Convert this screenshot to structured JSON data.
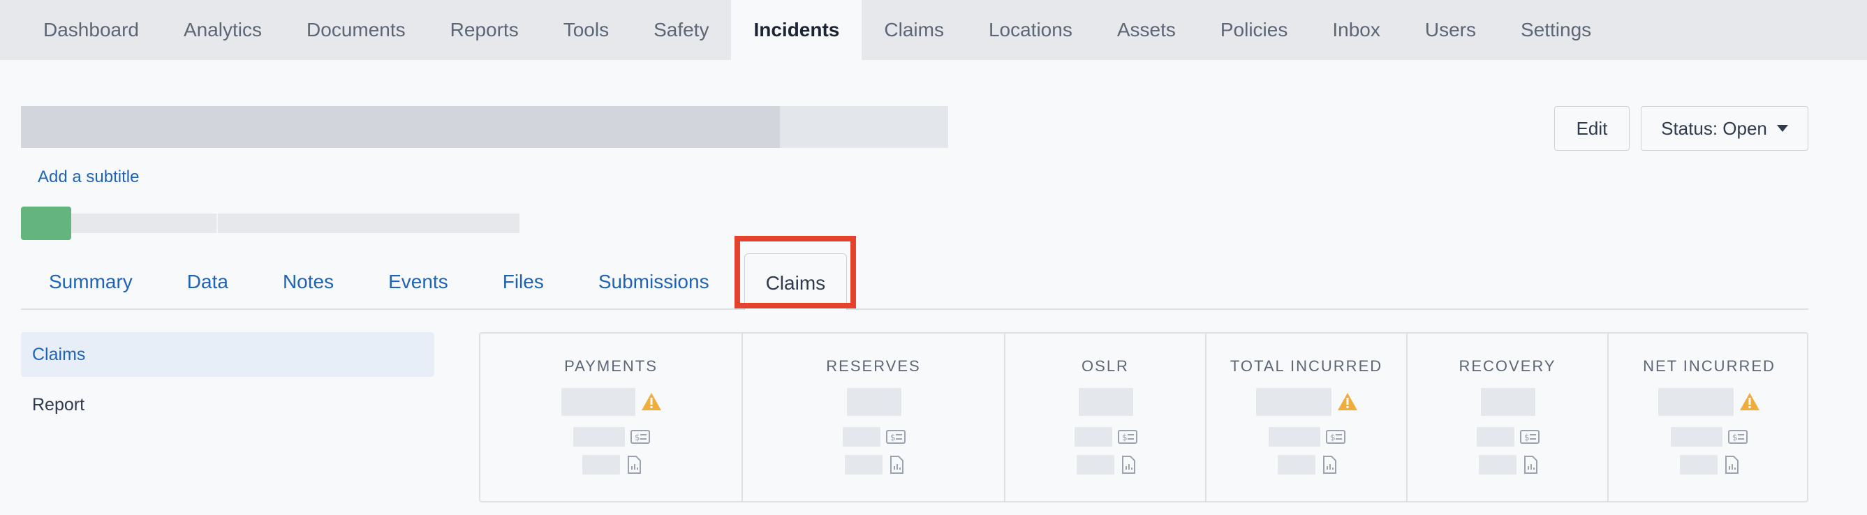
{
  "nav": {
    "items": [
      "Dashboard",
      "Analytics",
      "Documents",
      "Reports",
      "Tools",
      "Safety",
      "Incidents",
      "Claims",
      "Locations",
      "Assets",
      "Policies",
      "Inbox",
      "Users",
      "Settings"
    ],
    "active": "Incidents"
  },
  "header": {
    "subtitle_link": "Add a subtitle",
    "edit_label": "Edit",
    "status_label": "Status: Open"
  },
  "tabs": {
    "items": [
      "Summary",
      "Data",
      "Notes",
      "Events",
      "Files",
      "Submissions",
      "Claims"
    ],
    "active": "Claims"
  },
  "sidebar": {
    "items": [
      "Claims",
      "Report"
    ],
    "active": "Claims"
  },
  "stats": {
    "columns": [
      "PAYMENTS",
      "RESERVES",
      "OSLR",
      "TOTAL INCURRED",
      "RECOVERY",
      "NET INCURRED"
    ],
    "warning_columns": [
      "PAYMENTS",
      "TOTAL INCURRED",
      "NET INCURRED"
    ]
  },
  "colors": {
    "accent": "#1f63b6",
    "highlight": "#e5422e",
    "progress": "#63b47f",
    "warning": "#f0ad3c"
  },
  "icons": [
    "warning-icon",
    "money-icon",
    "document-chart-icon",
    "caret-down-icon"
  ]
}
